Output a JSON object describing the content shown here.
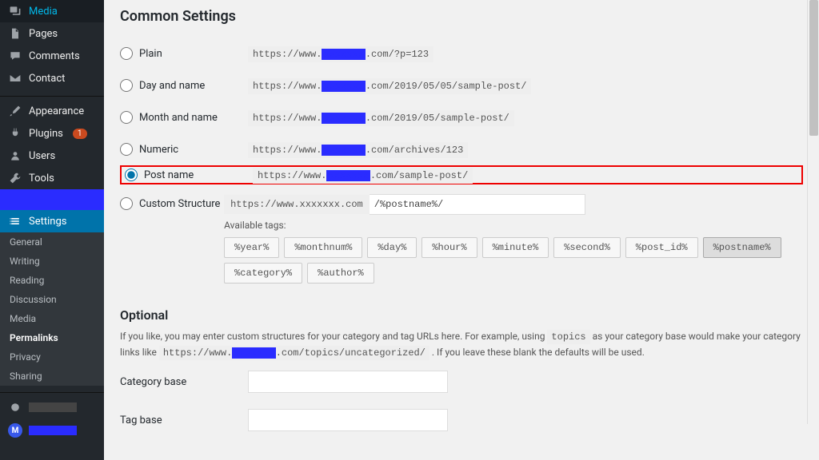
{
  "sidebar": {
    "top": [
      {
        "label": "Media",
        "icon": "media"
      },
      {
        "label": "Pages",
        "icon": "page"
      },
      {
        "label": "Comments",
        "icon": "comment"
      },
      {
        "label": "Contact",
        "icon": "mail"
      }
    ],
    "mid": [
      {
        "label": "Appearance",
        "icon": "brush"
      },
      {
        "label": "Plugins",
        "icon": "plug",
        "badge": "1"
      },
      {
        "label": "Users",
        "icon": "user"
      },
      {
        "label": "Tools",
        "icon": "wrench"
      }
    ],
    "settings_label": "Settings",
    "submenu": [
      {
        "label": "General",
        "current": false
      },
      {
        "label": "Writing",
        "current": false
      },
      {
        "label": "Reading",
        "current": false
      },
      {
        "label": "Discussion",
        "current": false
      },
      {
        "label": "Media",
        "current": false
      },
      {
        "label": "Permalinks",
        "current": true
      },
      {
        "label": "Privacy",
        "current": false
      },
      {
        "label": "Sharing",
        "current": false
      }
    ],
    "avatar_initial": "M"
  },
  "page": {
    "heading": "Common Settings",
    "options": [
      {
        "key": "plain",
        "label": "Plain",
        "ex_pre": "https://www.",
        "ex_post": ".com/?p=123",
        "checked": false
      },
      {
        "key": "dayname",
        "label": "Day and name",
        "ex_pre": "https://www.",
        "ex_post": ".com/2019/05/05/sample-post/",
        "checked": false
      },
      {
        "key": "monthname",
        "label": "Month and name",
        "ex_pre": "https://www.",
        "ex_post": ".com/2019/05/sample-post/",
        "checked": false
      },
      {
        "key": "numeric",
        "label": "Numeric",
        "ex_pre": "https://www.",
        "ex_post": ".com/archives/123",
        "checked": false
      },
      {
        "key": "postname",
        "label": "Post name",
        "ex_pre": "https://www.",
        "ex_post": ".com/sample-post/",
        "checked": true,
        "highlight": true
      },
      {
        "key": "custom",
        "label": "Custom Structure",
        "checked": false
      }
    ],
    "custom_prefix_pre": "https://www.",
    "custom_prefix_post": ".com",
    "custom_value": "/%postname%/",
    "available_label": "Available tags:",
    "tags": [
      "%year%",
      "%monthnum%",
      "%day%",
      "%hour%",
      "%minute%",
      "%second%",
      "%post_id%",
      "%postname%",
      "%category%",
      "%author%"
    ],
    "tag_selected": "%postname%",
    "optional_heading": "Optional",
    "optional_desc_1": "If you like, you may enter custom structures for your category and tag URLs here. For example, using ",
    "optional_desc_code1": "topics",
    "optional_desc_2": " as your category base would make your category links like ",
    "optional_desc_code2_pre": "https://www.",
    "optional_desc_code2_post": ".com/topics/uncategorized/",
    "optional_desc_3": " . If you leave these blank the defaults will be used.",
    "category_base_label": "Category base",
    "tag_base_label": "Tag base"
  }
}
